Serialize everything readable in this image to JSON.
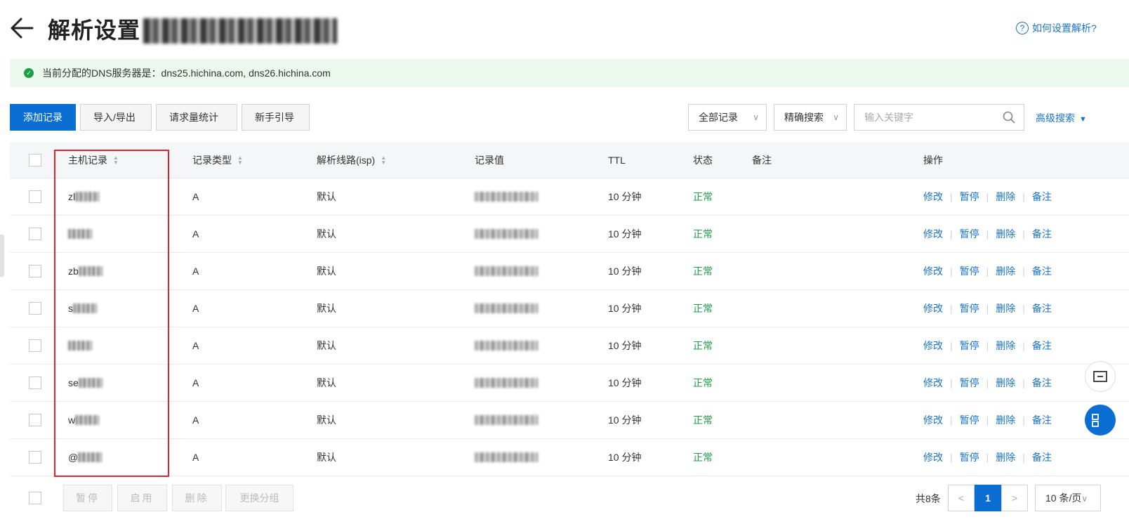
{
  "header": {
    "title": "解析设置",
    "help_link": "如何设置解析?",
    "help_icon": "?"
  },
  "alert": {
    "text": "当前分配的DNS服务器是：dns25.hichina.com, dns26.hichina.com",
    "check": "✓"
  },
  "toolbar": {
    "add_record": "添加记录",
    "import_export": "导入/导出",
    "request_stats": "请求量统计",
    "guide": "新手引导"
  },
  "filters": {
    "record_filter": "全部记录",
    "search_mode": "精确搜索",
    "search_placeholder": "输入关键字",
    "advanced_search": "高级搜索",
    "chevron": "∨",
    "triangle": "▼"
  },
  "table": {
    "columns": {
      "host": "主机记录",
      "type": "记录类型",
      "line": "解析线路(isp)",
      "value": "记录值",
      "ttl": "TTL",
      "status": "状态",
      "remark": "备注",
      "ops": "操作"
    },
    "rows": [
      {
        "host": "zl",
        "type": "A",
        "line": "默认",
        "ttl": "10 分钟",
        "status": "正常"
      },
      {
        "host": "",
        "type": "A",
        "line": "默认",
        "ttl": "10 分钟",
        "status": "正常"
      },
      {
        "host": "zb",
        "type": "A",
        "line": "默认",
        "ttl": "10 分钟",
        "status": "正常"
      },
      {
        "host": "s",
        "type": "A",
        "line": "默认",
        "ttl": "10 分钟",
        "status": "正常"
      },
      {
        "host": "",
        "type": "A",
        "line": "默认",
        "ttl": "10 分钟",
        "status": "正常"
      },
      {
        "host": "se",
        "type": "A",
        "line": "默认",
        "ttl": "10 分钟",
        "status": "正常"
      },
      {
        "host": "w",
        "type": "A",
        "line": "默认",
        "ttl": "10 分钟",
        "status": "正常"
      },
      {
        "host": "@",
        "type": "A",
        "line": "默认",
        "ttl": "10 分钟",
        "status": "正常"
      }
    ],
    "actions": {
      "edit": "修改",
      "pause": "暂停",
      "delete": "删除",
      "remark": "备注",
      "separator": "|"
    }
  },
  "footer": {
    "pause": "暂停",
    "enable": "启用",
    "delete": "删除",
    "change_group": "更换分组",
    "total": "共8条",
    "prev": "<",
    "current_page": "1",
    "next": ">",
    "page_size": "10 条/页",
    "page_size_chevron": "∨"
  },
  "colors": {
    "primary": "#0b6ed3",
    "link": "#1a73c8",
    "success": "#1e9e46",
    "highlight": "#e0262b"
  }
}
